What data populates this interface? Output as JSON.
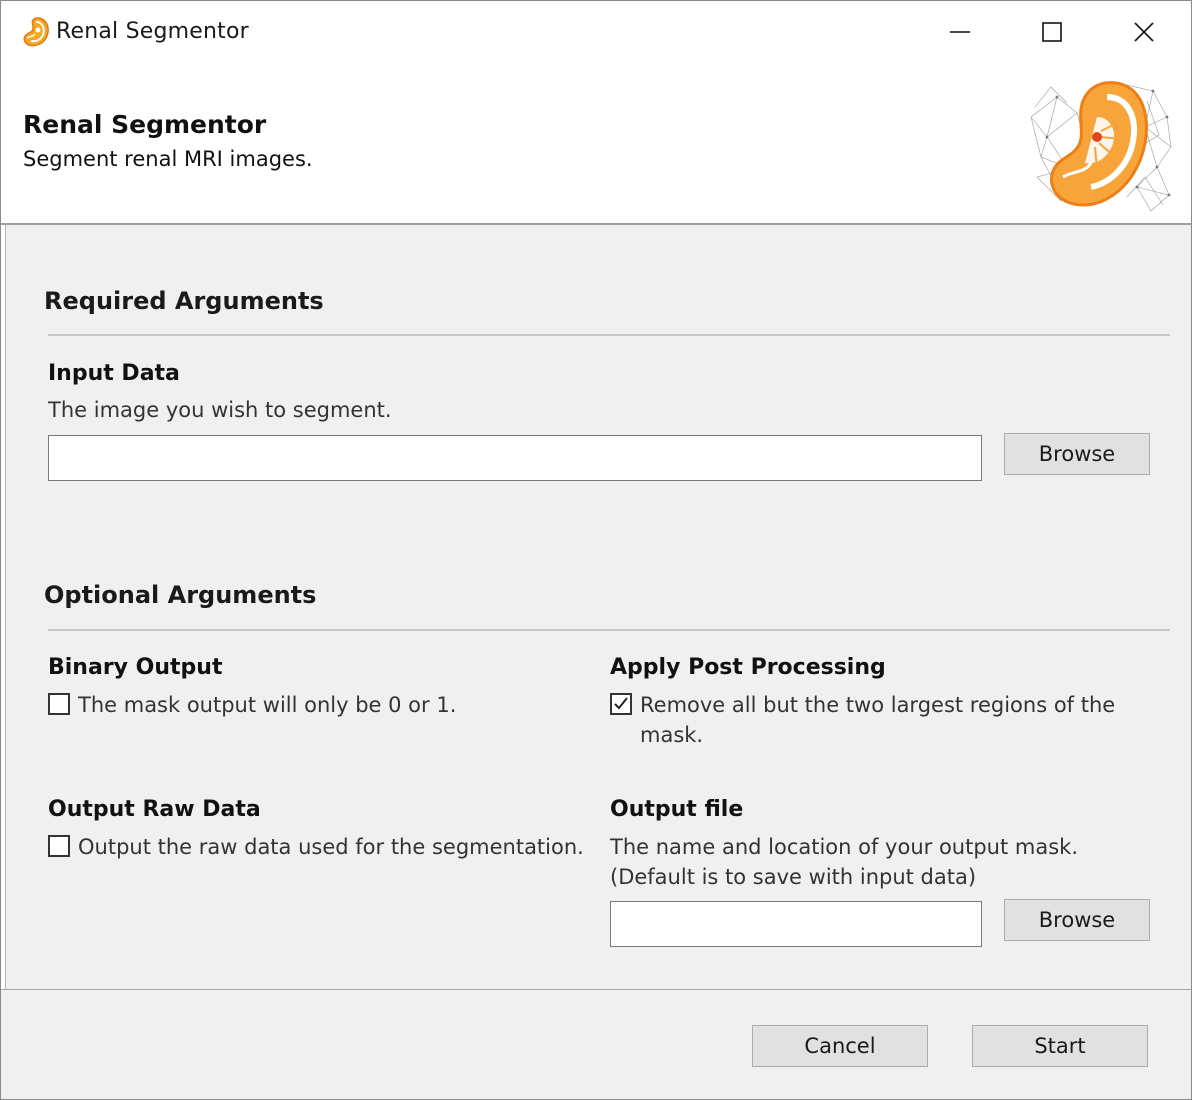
{
  "window": {
    "title": "Renal Segmentor",
    "icon": "kidney-icon",
    "controls": [
      "minimize-icon",
      "maximize-icon",
      "close-icon"
    ]
  },
  "banner": {
    "title": "Renal Segmentor",
    "subtitle": "Segment renal MRI images.",
    "logo": "kidney-logo"
  },
  "required": {
    "section_title": "Required Arguments",
    "input_data": {
      "label": "Input Data",
      "description": "The image you wish to segment.",
      "value": "",
      "browse_label": "Browse"
    }
  },
  "optional": {
    "section_title": "Optional Arguments",
    "binary_output": {
      "label": "Binary Output",
      "checkbox_text": "The mask output will only be 0 or 1.",
      "checked": false
    },
    "post_processing": {
      "label": "Apply Post Processing",
      "checkbox_text_line1": "Remove all but the two largest regions of the",
      "checkbox_text_line2": "mask.",
      "checked": true
    },
    "raw_data": {
      "label": "Output Raw Data",
      "checkbox_text": "Output the raw data used for the segmentation.",
      "checked": false
    },
    "output_file": {
      "label": "Output file",
      "description_line1": "The name and location of your output mask.",
      "description_line2": "(Default is to save with input data)",
      "value": "",
      "browse_label": "Browse"
    }
  },
  "footer": {
    "cancel_label": "Cancel",
    "start_label": "Start"
  },
  "colors": {
    "accent_orange": "#f5821f",
    "panel_background": "#f0f0f0",
    "button_background": "#e1e1e1"
  }
}
